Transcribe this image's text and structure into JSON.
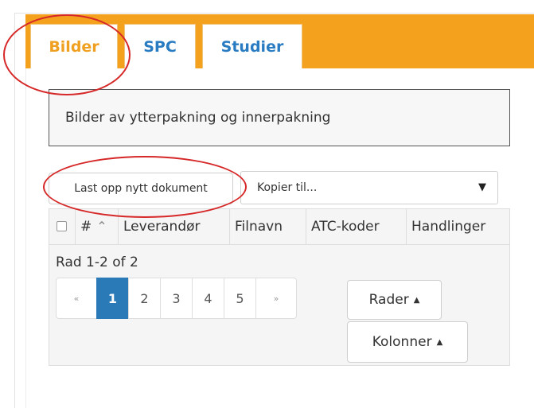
{
  "tabs": [
    {
      "label": "Bilder",
      "active": true
    },
    {
      "label": "SPC",
      "active": false
    },
    {
      "label": "Studier",
      "active": false
    }
  ],
  "description": "Bilder av ytterpakning og innerpakning",
  "toolbar": {
    "upload_label": "Last opp nytt dokument",
    "copy_select_value": "Kopier til..."
  },
  "table": {
    "columns": [
      "#",
      "Leverandør",
      "Filnavn",
      "ATC-koder",
      "Handlinger"
    ],
    "row_info": "Rad 1-2 of 2"
  },
  "pagination": {
    "prev": "«",
    "pages": [
      "1",
      "2",
      "3",
      "4",
      "5"
    ],
    "next": "»",
    "current": "1"
  },
  "buttons": {
    "rows_label": "Rader",
    "columns_label": "Kolonner"
  },
  "colors": {
    "accent_orange": "#f4a21e",
    "tab_active_text": "#f0a020",
    "tab_text": "#2a7cc2",
    "page_active": "#2b7ab8",
    "annotation_red": "#d62828"
  }
}
